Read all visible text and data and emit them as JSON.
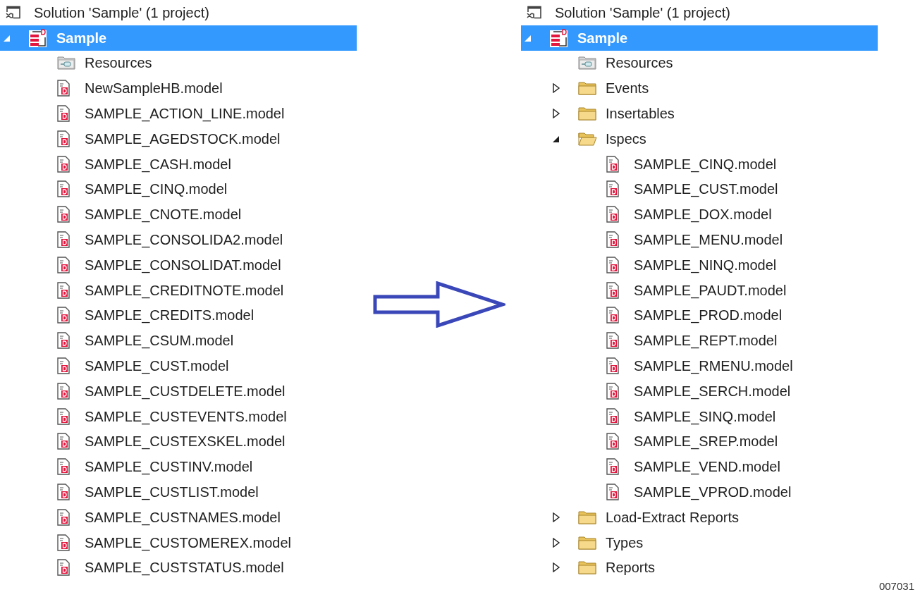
{
  "panes": [
    {
      "solution": "Solution 'Sample' (1 project)",
      "project": {
        "name": "Sample",
        "selected": true,
        "expanded": true,
        "children": [
          {
            "kind": "resources",
            "name": "Resources"
          },
          {
            "kind": "file",
            "name": "NewSampleHB.model"
          },
          {
            "kind": "file",
            "name": "SAMPLE_ACTION_LINE.model"
          },
          {
            "kind": "file",
            "name": "SAMPLE_AGEDSTOCK.model"
          },
          {
            "kind": "file",
            "name": "SAMPLE_CASH.model"
          },
          {
            "kind": "file",
            "name": "SAMPLE_CINQ.model"
          },
          {
            "kind": "file",
            "name": "SAMPLE_CNOTE.model"
          },
          {
            "kind": "file",
            "name": "SAMPLE_CONSOLIDA2.model"
          },
          {
            "kind": "file",
            "name": "SAMPLE_CONSOLIDAT.model"
          },
          {
            "kind": "file",
            "name": "SAMPLE_CREDITNOTE.model"
          },
          {
            "kind": "file",
            "name": "SAMPLE_CREDITS.model"
          },
          {
            "kind": "file",
            "name": "SAMPLE_CSUM.model"
          },
          {
            "kind": "file",
            "name": "SAMPLE_CUST.model"
          },
          {
            "kind": "file",
            "name": "SAMPLE_CUSTDELETE.model"
          },
          {
            "kind": "file",
            "name": "SAMPLE_CUSTEVENTS.model"
          },
          {
            "kind": "file",
            "name": "SAMPLE_CUSTEXSKEL.model"
          },
          {
            "kind": "file",
            "name": "SAMPLE_CUSTINV.model"
          },
          {
            "kind": "file",
            "name": "SAMPLE_CUSTLIST.model"
          },
          {
            "kind": "file",
            "name": "SAMPLE_CUSTNAMES.model"
          },
          {
            "kind": "file",
            "name": "SAMPLE_CUSTOMEREX.model"
          },
          {
            "kind": "file",
            "name": "SAMPLE_CUSTSTATUS.model"
          }
        ]
      }
    },
    {
      "solution": "Solution 'Sample' (1 project)",
      "project": {
        "name": "Sample",
        "selected": true,
        "expanded": true,
        "children": [
          {
            "kind": "resources",
            "name": "Resources"
          },
          {
            "kind": "folder",
            "name": "Events",
            "expanded": false
          },
          {
            "kind": "folder",
            "name": "Insertables",
            "expanded": false
          },
          {
            "kind": "folder",
            "name": "Ispecs",
            "expanded": true,
            "children": [
              {
                "kind": "file",
                "name": "SAMPLE_CINQ.model"
              },
              {
                "kind": "file",
                "name": "SAMPLE_CUST.model"
              },
              {
                "kind": "file",
                "name": "SAMPLE_DOX.model"
              },
              {
                "kind": "file",
                "name": "SAMPLE_MENU.model"
              },
              {
                "kind": "file",
                "name": "SAMPLE_NINQ.model"
              },
              {
                "kind": "file",
                "name": "SAMPLE_PAUDT.model"
              },
              {
                "kind": "file",
                "name": "SAMPLE_PROD.model"
              },
              {
                "kind": "file",
                "name": "SAMPLE_REPT.model"
              },
              {
                "kind": "file",
                "name": "SAMPLE_RMENU.model"
              },
              {
                "kind": "file",
                "name": "SAMPLE_SERCH.model"
              },
              {
                "kind": "file",
                "name": "SAMPLE_SINQ.model"
              },
              {
                "kind": "file",
                "name": "SAMPLE_SREP.model"
              },
              {
                "kind": "file",
                "name": "SAMPLE_VEND.model"
              },
              {
                "kind": "file",
                "name": "SAMPLE_VPROD.model"
              }
            ]
          },
          {
            "kind": "folder",
            "name": "Load-Extract Reports",
            "expanded": false
          },
          {
            "kind": "folder",
            "name": "Types",
            "expanded": false
          },
          {
            "kind": "folder",
            "name": "Reports",
            "expanded": false
          }
        ]
      }
    }
  ],
  "figure_id": "007031"
}
